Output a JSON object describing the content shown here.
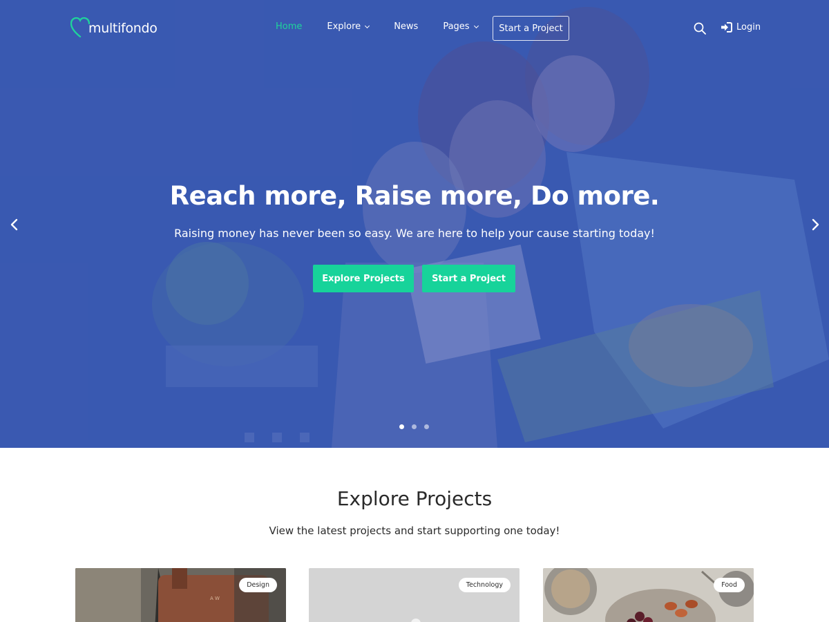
{
  "brand": {
    "name": "multifondo",
    "accent": "#1fd49b",
    "hero_overlay": "#3a58ae"
  },
  "nav": {
    "items": [
      {
        "label": "Home",
        "active": true
      },
      {
        "label": "Explore",
        "dropdown": true
      },
      {
        "label": "News"
      },
      {
        "label": "Pages",
        "dropdown": true
      }
    ],
    "cta_label": "Start a Project",
    "search_icon": "search-icon",
    "login_label": "Login",
    "login_icon": "sign-in-icon"
  },
  "hero": {
    "title": "Reach more, Raise more, Do more.",
    "subtitle": "Raising money has never been so easy. We are here to help your cause starting today!",
    "primary_button": "Explore Projects",
    "secondary_button": "Start a Project",
    "slides_count": 3,
    "active_slide": 1
  },
  "explore": {
    "title": "Explore Projects",
    "subtitle": "View the latest projects and start supporting one today!",
    "cards": [
      {
        "category": "Design"
      },
      {
        "category": "Technology"
      },
      {
        "category": "Food"
      }
    ]
  }
}
